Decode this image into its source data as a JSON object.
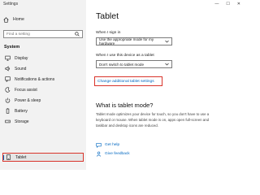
{
  "window": {
    "title": "Settings"
  },
  "window_controls": {
    "minimize": "—",
    "maximize": "☐",
    "close": "✕"
  },
  "sidebar": {
    "home_label": "Home",
    "search": {
      "placeholder": "Find a setting"
    },
    "section_title": "System",
    "items": [
      {
        "label": "Display",
        "icon": "display-icon"
      },
      {
        "label": "Sound",
        "icon": "sound-icon"
      },
      {
        "label": "Notifications & actions",
        "icon": "notifications-icon"
      },
      {
        "label": "Focus assist",
        "icon": "focus-assist-icon"
      },
      {
        "label": "Power & sleep",
        "icon": "power-icon"
      },
      {
        "label": "Battery",
        "icon": "battery-icon"
      },
      {
        "label": "Storage",
        "icon": "storage-icon"
      },
      {
        "label": "Tablet",
        "icon": "tablet-icon",
        "selected": true
      }
    ]
  },
  "main": {
    "title": "Tablet",
    "sign_in": {
      "label": "When I sign in",
      "value": "Use the appropriate mode for my hardware"
    },
    "as_tablet": {
      "label": "When I use this device as a tablet",
      "value": "Don't switch to tablet mode"
    },
    "additional_link": "Change additional tablet settings",
    "what_is": {
      "heading": "What is tablet mode?",
      "line1": "Tablet mode optimizes your device for touch, so you don't have to use a",
      "line2": "keyboard or mouse. When tablet mode is on, apps open full-screen and",
      "line3": "taskbar and desktop icons are reduced."
    },
    "get_help": "Get help",
    "give_feedback": "Give feedback"
  },
  "colors": {
    "accent": "#0067c0",
    "highlight": "#d9342b",
    "sidebar_bg": "#f2f2f2"
  }
}
